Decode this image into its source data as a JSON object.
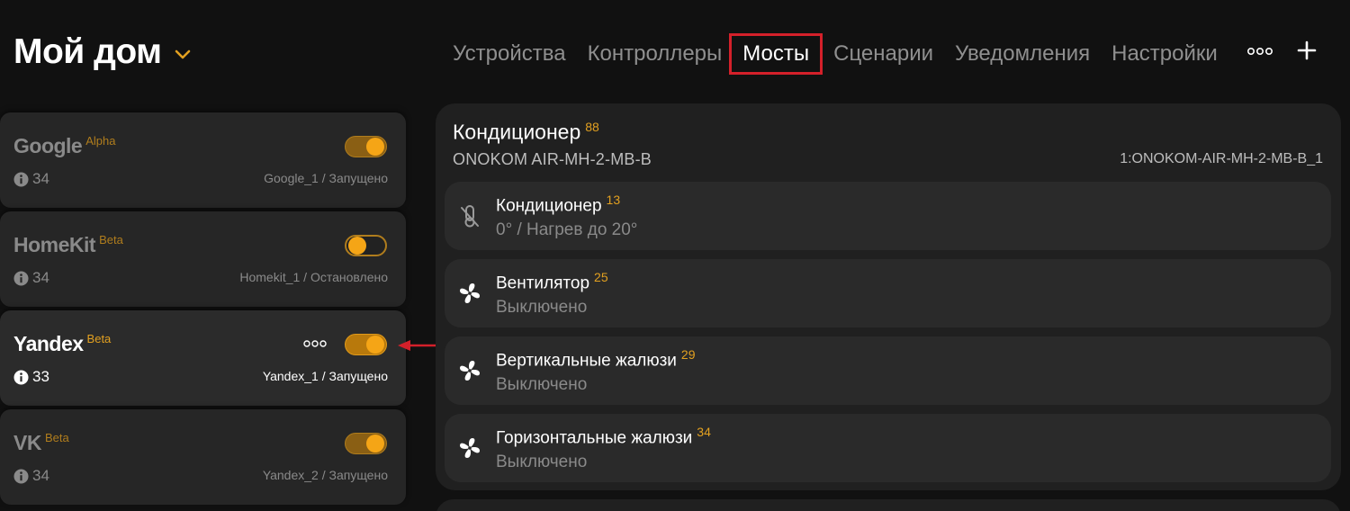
{
  "header": {
    "home_title": "Мой дом",
    "tabs": [
      {
        "label": "Устройства"
      },
      {
        "label": "Контроллеры"
      },
      {
        "label": "Мосты"
      },
      {
        "label": "Сценарии"
      },
      {
        "label": "Уведомления"
      },
      {
        "label": "Настройки"
      }
    ],
    "active_tab": "Мосты"
  },
  "bridges": [
    {
      "name": "Google",
      "tag": "Alpha",
      "count": "34",
      "status": "Google_1 / Запущено",
      "enabled": true
    },
    {
      "name": "HomeKit",
      "tag": "Beta",
      "count": "34",
      "status": "Homekit_1 / Остановлено",
      "enabled": false
    },
    {
      "name": "Yandex",
      "tag": "Beta",
      "count": "33",
      "status": "Yandex_1 / Запущено",
      "enabled": true
    },
    {
      "name": "VK",
      "tag": "Beta",
      "count": "34",
      "status": "Yandex_2 / Запущено",
      "enabled": true
    }
  ],
  "device": {
    "title": "Кондиционер",
    "title_count": "88",
    "model": "ONOKOM AIR-MH-2-MB-B",
    "id": "1:ONOKOM-AIR-MH-2-MB-B_1",
    "features": [
      {
        "name": "Кондиционер",
        "count": "13",
        "value": "0° / Нагрев до 20°",
        "icon": "thermometer-off-icon"
      },
      {
        "name": "Вентилятор",
        "count": "25",
        "value": "Выключено",
        "icon": "fan-icon"
      },
      {
        "name": "Вертикальные жалюзи",
        "count": "29",
        "value": "Выключено",
        "icon": "fan-icon"
      },
      {
        "name": "Горизонтальные жалюзи",
        "count": "34",
        "value": "Выключено",
        "icon": "fan-icon"
      }
    ]
  },
  "colors": {
    "accent": "#f5a516",
    "highlight_box": "#d4202a",
    "background": "#111111"
  }
}
